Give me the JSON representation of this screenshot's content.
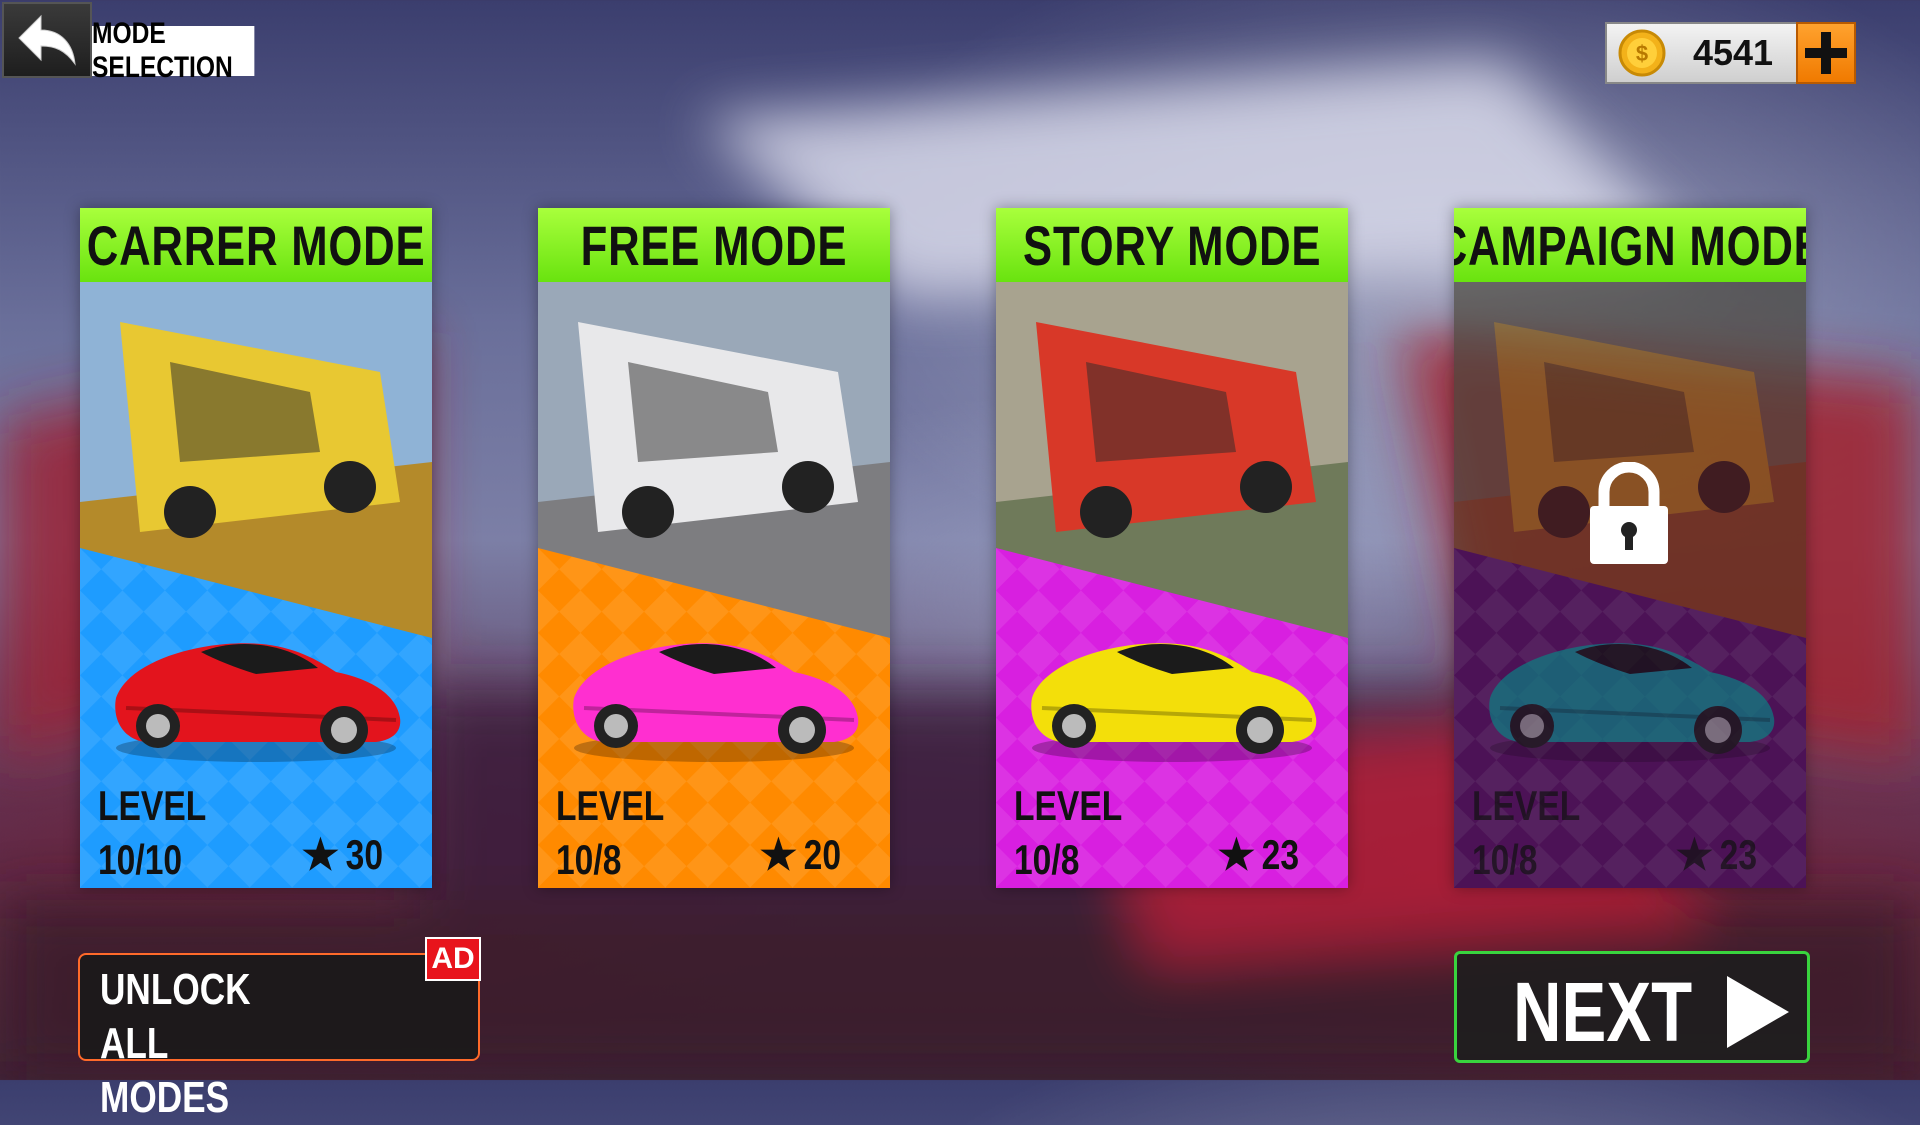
{
  "header": {
    "title": "MODE SELECTION",
    "back_icon": "back-arrow-icon"
  },
  "currency": {
    "icon": "coin-icon",
    "amount": "4541",
    "add_icon": "plus-icon"
  },
  "modes": [
    {
      "title": "CARRER MODE",
      "level_label": "LEVEL",
      "level_value": "10/10",
      "stars": "30",
      "locked": false,
      "theme_color": "#1e9cff",
      "car_color": "#e3141d"
    },
    {
      "title": "FREE MODE",
      "level_label": "LEVEL",
      "level_value": "10/8",
      "stars": "20",
      "locked": false,
      "theme_color": "#ff8a00",
      "car_color": "#ff2fd0"
    },
    {
      "title": "STORY MODE",
      "level_label": "LEVEL",
      "level_value": "10/8",
      "stars": "23",
      "locked": false,
      "theme_color": "#d81fe0",
      "car_color": "#f3df0a"
    },
    {
      "title": "CAMPAIGN MODE",
      "level_label": "LEVEL",
      "level_value": "10/8",
      "stars": "23",
      "locked": true,
      "theme_color": "#6a1a78",
      "car_color": "#15a7b2"
    }
  ],
  "footer": {
    "unlock_line1": "UNLOCK ALL",
    "unlock_line2": "MODES",
    "ad_badge": "AD",
    "next_label": "NEXT"
  }
}
